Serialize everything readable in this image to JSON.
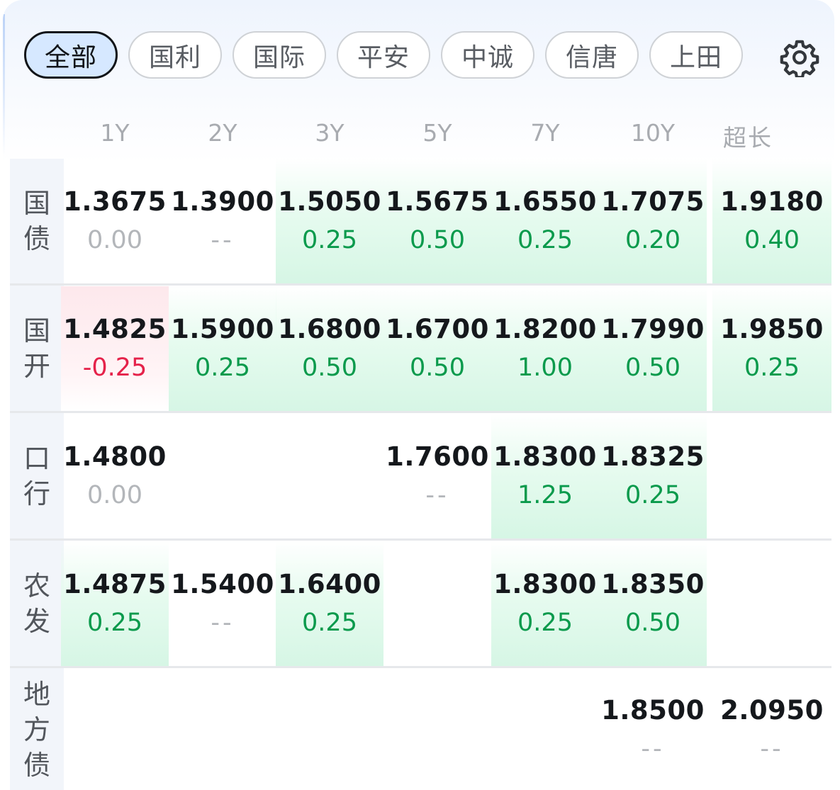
{
  "filters": [
    "全部",
    "国利",
    "国际",
    "平安",
    "中诚",
    "信唐",
    "上田"
  ],
  "active_filter": "全部",
  "icons": {
    "settings": "gear-icon"
  },
  "columns": [
    "1Y",
    "2Y",
    "3Y",
    "5Y",
    "7Y",
    "10Y",
    "超长"
  ],
  "rows": [
    {
      "label_chars": [
        "国",
        "债"
      ],
      "cells": [
        {
          "rate": "1.3675",
          "change": "0.00",
          "trend": "flat"
        },
        {
          "rate": "1.3900",
          "change": "--",
          "trend": "none"
        },
        {
          "rate": "1.5050",
          "change": "0.25",
          "trend": "up"
        },
        {
          "rate": "1.5675",
          "change": "0.50",
          "trend": "up"
        },
        {
          "rate": "1.6550",
          "change": "0.25",
          "trend": "up"
        },
        {
          "rate": "1.7075",
          "change": "0.20",
          "trend": "up"
        },
        {
          "rate": "1.9180",
          "change": "0.40",
          "trend": "up"
        }
      ]
    },
    {
      "label_chars": [
        "国",
        "开"
      ],
      "cells": [
        {
          "rate": "1.4825",
          "change": "-0.25",
          "trend": "down"
        },
        {
          "rate": "1.5900",
          "change": "0.25",
          "trend": "up"
        },
        {
          "rate": "1.6800",
          "change": "0.50",
          "trend": "up"
        },
        {
          "rate": "1.6700",
          "change": "0.50",
          "trend": "up"
        },
        {
          "rate": "1.8200",
          "change": "1.00",
          "trend": "up"
        },
        {
          "rate": "1.7990",
          "change": "0.50",
          "trend": "up"
        },
        {
          "rate": "1.9850",
          "change": "0.25",
          "trend": "up"
        }
      ]
    },
    {
      "label_chars": [
        "口",
        "行"
      ],
      "cells": [
        {
          "rate": "1.4800",
          "change": "0.00",
          "trend": "flat"
        },
        null,
        null,
        {
          "rate": "1.7600",
          "change": "--",
          "trend": "none"
        },
        {
          "rate": "1.8300",
          "change": "1.25",
          "trend": "up"
        },
        {
          "rate": "1.8325",
          "change": "0.25",
          "trend": "up"
        },
        null
      ]
    },
    {
      "label_chars": [
        "农",
        "发"
      ],
      "cells": [
        {
          "rate": "1.4875",
          "change": "0.25",
          "trend": "up"
        },
        {
          "rate": "1.5400",
          "change": "--",
          "trend": "none"
        },
        {
          "rate": "1.6400",
          "change": "0.25",
          "trend": "up"
        },
        null,
        {
          "rate": "1.8300",
          "change": "0.25",
          "trend": "up"
        },
        {
          "rate": "1.8350",
          "change": "0.50",
          "trend": "up"
        },
        null
      ]
    },
    {
      "label_chars": [
        "地",
        "方",
        "债"
      ],
      "cells": [
        null,
        null,
        null,
        null,
        null,
        {
          "rate": "1.8500",
          "change": "--",
          "trend": "none"
        },
        {
          "rate": "2.0950",
          "change": "--",
          "trend": "none"
        }
      ]
    }
  ],
  "colors": {
    "up": "#0a9a4c",
    "down": "#e5224a",
    "neutral": "#b3b6ba",
    "active_pill_bg": "#d6e8ff"
  }
}
